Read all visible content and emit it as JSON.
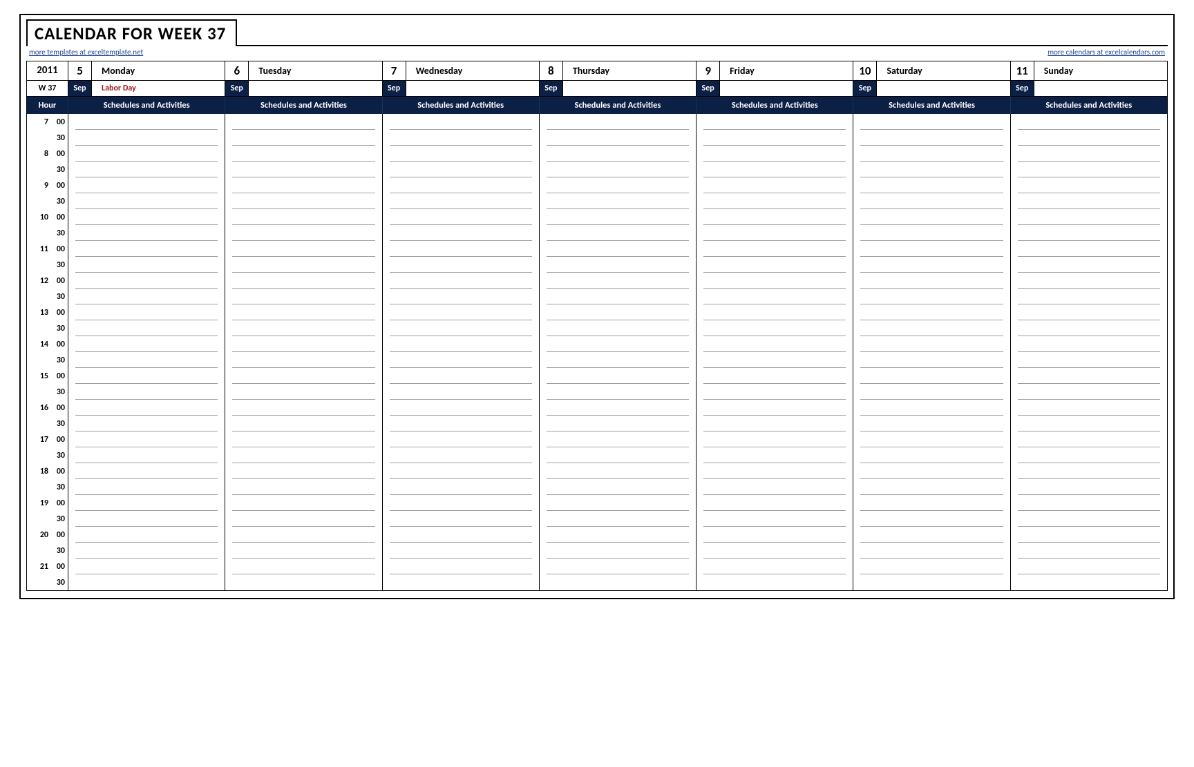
{
  "title": "CALENDAR FOR WEEK 37",
  "links": {
    "left": "more templates at exceltemplate.net",
    "right": "more calendars at excelcalendars.com"
  },
  "year": "2011",
  "week_label": "W 37",
  "hour_header": "Hour",
  "schedule_header": "Schedules and Activities",
  "days": [
    {
      "num": "5",
      "name": "Monday",
      "month": "Sep",
      "note": "Labor Day"
    },
    {
      "num": "6",
      "name": "Tuesday",
      "month": "Sep",
      "note": ""
    },
    {
      "num": "7",
      "name": "Wednesday",
      "month": "Sep",
      "note": ""
    },
    {
      "num": "8",
      "name": "Thursday",
      "month": "Sep",
      "note": ""
    },
    {
      "num": "9",
      "name": "Friday",
      "month": "Sep",
      "note": ""
    },
    {
      "num": "10",
      "name": "Saturday",
      "month": "Sep",
      "note": ""
    },
    {
      "num": "11",
      "name": "Sunday",
      "month": "Sep",
      "note": ""
    }
  ],
  "hours": [
    "7",
    "8",
    "9",
    "10",
    "11",
    "12",
    "13",
    "14",
    "15",
    "16",
    "17",
    "18",
    "19",
    "20",
    "21"
  ],
  "minutes": [
    "00",
    "30"
  ]
}
